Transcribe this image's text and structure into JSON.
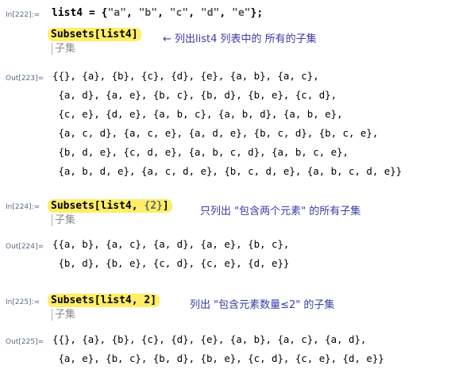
{
  "cells": {
    "in222": {
      "label": "In[222]:=",
      "var": "list4",
      "assign": " = {",
      "items": [
        "\"a\"",
        "\"b\"",
        "\"c\"",
        "\"d\"",
        "\"e\""
      ],
      "sep": ", ",
      "close": "};"
    },
    "in223": {
      "input": "Subsets[list4]",
      "hint": "子集",
      "note": "← 列出list4 列表中的 所有的子集"
    },
    "out223": {
      "label": "Out[223]=",
      "lines": [
        "{{}, {a}, {b}, {c}, {d}, {e}, {a, b}, {a, c},",
        " {a, d}, {a, e}, {b, c}, {b, d}, {b, e}, {c, d},",
        " {c, e}, {d, e}, {a, b, c}, {a, b, d}, {a, b, e},",
        " {a, c, d}, {a, c, e}, {a, d, e}, {b, c, d}, {b, c, e},",
        " {b, d, e}, {c, d, e}, {a, b, c, d}, {a, b, c, e},",
        " {a, b, d, e}, {a, c, d, e}, {b, c, d, e}, {a, b, c, d, e}}"
      ]
    },
    "in224": {
      "label": "In[224]:=",
      "fn": "Subsets[list4, ",
      "group": "{2}",
      "close": "]",
      "hint": "子集",
      "note": "只列出 \"包含两个元素\" 的所有子集"
    },
    "out224": {
      "label": "Out[224]=",
      "lines": [
        "{{a, b}, {a, c}, {a, d}, {a, e}, {b, c},",
        " {b, d}, {b, e}, {c, d}, {c, e}, {d, e}}"
      ]
    },
    "in225": {
      "label": "In[225]:=",
      "input": "Subsets[list4, 2]",
      "hint": "子集",
      "note": "列出 \"包含元素数量≤2\" 的子集"
    },
    "out225": {
      "label": "Out[225]=",
      "lines": [
        "{{}, {a}, {b}, {c}, {d}, {e}, {a, b}, {a, c}, {a, d},",
        " {a, e}, {b, c}, {b, d}, {b, e}, {c, d}, {c, e}, {d, e}}"
      ]
    }
  }
}
